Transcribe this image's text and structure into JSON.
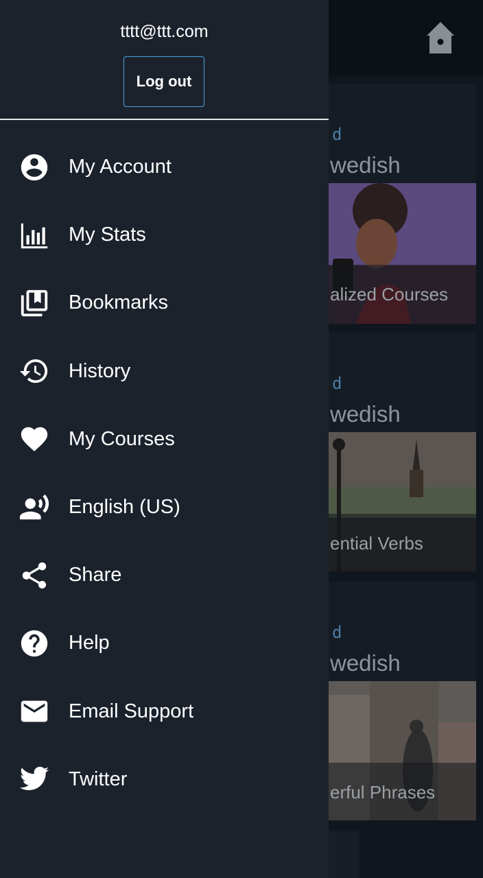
{
  "drawer": {
    "email": "tttt@ttt.com",
    "logout_label": "Log out",
    "items": [
      {
        "label": "My Account",
        "icon": "account-circle-icon"
      },
      {
        "label": "My Stats",
        "icon": "stats-icon"
      },
      {
        "label": "Bookmarks",
        "icon": "bookmarks-icon"
      },
      {
        "label": "History",
        "icon": "history-icon"
      },
      {
        "label": "My Courses",
        "icon": "heart-icon"
      },
      {
        "label": "English (US)",
        "icon": "voice-icon"
      },
      {
        "label": "Share",
        "icon": "share-icon"
      },
      {
        "label": "Help",
        "icon": "help-icon"
      },
      {
        "label": "Email Support",
        "icon": "email-icon"
      },
      {
        "label": "Twitter",
        "icon": "twitter-icon"
      }
    ]
  },
  "background": {
    "cards": [
      {
        "kicker": "d",
        "title": "wedish",
        "label": "alized Courses"
      },
      {
        "kicker": "d",
        "title": "wedish",
        "label": "ential Verbs"
      },
      {
        "kicker": "d",
        "title": "wedish",
        "label": "erful Phrases"
      }
    ]
  },
  "colors": {
    "drawer_bg": "#1c222c",
    "accent_border": "#4aa3df",
    "text": "#ffffff"
  }
}
